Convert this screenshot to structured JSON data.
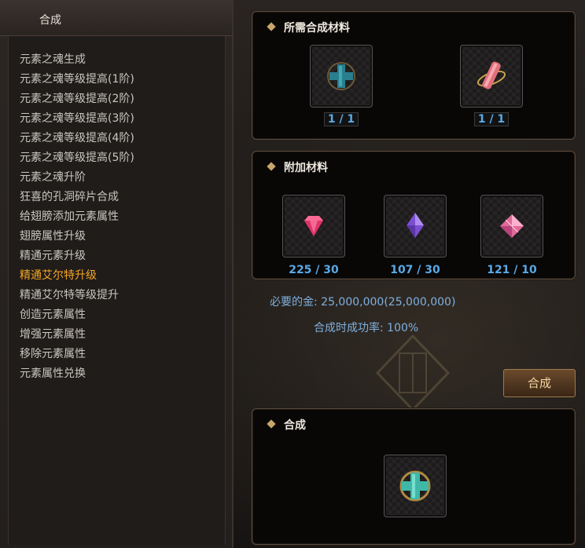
{
  "left_panel": {
    "title": "合成",
    "menu": [
      "元素之魂生成",
      "元素之魂等级提高(1阶)",
      "元素之魂等级提高(2阶)",
      "元素之魂等级提高(3阶)",
      "元素之魂等级提高(4阶)",
      "元素之魂等级提高(5阶)",
      "元素之魂升阶",
      "狂喜的孔洞碎片合成",
      "给翅膀添加元素属性",
      "翅膀属性升级",
      "精通元素升级",
      "精通艾尔特升级",
      "精通艾尔特等级提升",
      "创造元素属性",
      "增强元素属性",
      "移除元素属性",
      "元素属性兑换"
    ],
    "active_index": 11
  },
  "required_materials": {
    "title": "所需合成材料",
    "items": [
      {
        "icon": "teal-cross-gem-icon",
        "count": "1 / 1"
      },
      {
        "icon": "pink-scroll-icon",
        "count": "1 / 1"
      }
    ]
  },
  "additional_materials": {
    "title": "附加材料",
    "items": [
      {
        "icon": "red-gem-icon",
        "count": "225 / 30"
      },
      {
        "icon": "purple-gem-icon",
        "count": "107 / 30"
      },
      {
        "icon": "pink-gem-icon",
        "count": "121 / 10"
      }
    ]
  },
  "info": {
    "gold": "必要的金: 25,000,000(25,000,000)",
    "success_rate": "合成时成功率: 100%"
  },
  "combine_button": "合成",
  "result": {
    "title": "合成",
    "icon": "teal-cross-gem-icon"
  },
  "colors": {
    "active_menu": "#f5a623",
    "count_text": "#5aa9e6",
    "info_text": "#7fb0e0"
  }
}
